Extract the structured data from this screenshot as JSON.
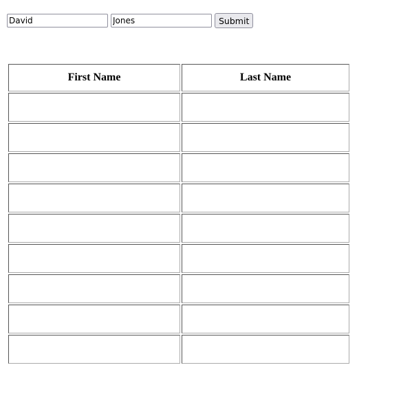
{
  "form": {
    "first_name_value": "David",
    "last_name_value": "Jones",
    "submit_label": "Submit"
  },
  "table": {
    "headers": [
      "First Name",
      "Last Name"
    ],
    "rows": [
      [
        "",
        ""
      ],
      [
        "",
        ""
      ],
      [
        "",
        ""
      ],
      [
        "",
        ""
      ],
      [
        "",
        ""
      ],
      [
        "",
        ""
      ],
      [
        "",
        ""
      ],
      [
        "",
        ""
      ],
      [
        "",
        ""
      ]
    ]
  }
}
